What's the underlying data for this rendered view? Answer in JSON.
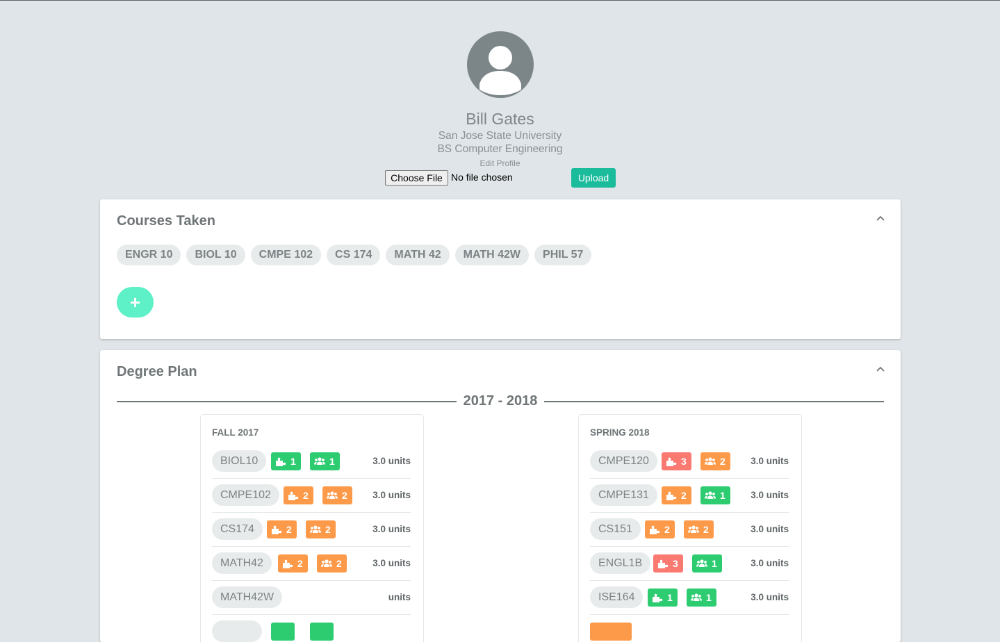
{
  "profile": {
    "name": "Bill Gates",
    "school": "San Jose State University",
    "degree": "BS Computer Engineering",
    "edit_link": "Edit Profile",
    "choose_file_label": "Choose File",
    "file_status": "No file chosen",
    "upload_label": "Upload"
  },
  "courses_taken": {
    "title": "Courses Taken",
    "courses": [
      "ENGR 10",
      "BIOL 10",
      "CMPE 102",
      "CS 174",
      "MATH 42",
      "MATH 42W",
      "PHIL 57"
    ],
    "add_label": "+"
  },
  "degree_plan": {
    "title": "Degree Plan",
    "year": "2017 - 2018",
    "terms": [
      {
        "title": "FALL 2017",
        "courses": [
          {
            "code": "BIOL10",
            "difficulty": "1",
            "difficulty_color": "green",
            "workload": "1",
            "workload_color": "green",
            "units": "3.0 units"
          },
          {
            "code": "CMPE102",
            "difficulty": "2",
            "difficulty_color": "orange",
            "workload": "2",
            "workload_color": "orange",
            "units": "3.0 units"
          },
          {
            "code": "CS174",
            "difficulty": "2",
            "difficulty_color": "orange",
            "workload": "2",
            "workload_color": "orange",
            "units": "3.0 units"
          },
          {
            "code": "MATH42",
            "difficulty": "2",
            "difficulty_color": "orange",
            "workload": "2",
            "workload_color": "orange",
            "units": "3.0 units"
          },
          {
            "code": "MATH42W",
            "units": "units"
          }
        ]
      },
      {
        "title": "SPRING 2018",
        "courses": [
          {
            "code": "CMPE120",
            "difficulty": "3",
            "difficulty_color": "red",
            "workload": "2",
            "workload_color": "orange",
            "units": "3.0 units"
          },
          {
            "code": "CMPE131",
            "difficulty": "2",
            "difficulty_color": "orange",
            "workload": "1",
            "workload_color": "green",
            "units": "3.0 units"
          },
          {
            "code": "CS151",
            "difficulty": "2",
            "difficulty_color": "orange",
            "workload": "2",
            "workload_color": "orange",
            "units": "3.0 units"
          },
          {
            "code": "ENGL1B",
            "difficulty": "3",
            "difficulty_color": "red",
            "workload": "1",
            "workload_color": "green",
            "units": "3.0 units"
          },
          {
            "code": "ISE164",
            "difficulty": "1",
            "difficulty_color": "green",
            "workload": "1",
            "workload_color": "green",
            "units": "3.0 units"
          }
        ]
      }
    ]
  },
  "icons": {
    "difficulty": "puzzle-icon",
    "workload": "users-icon",
    "collapse": "chevron-up-icon",
    "avatar": "user-avatar-icon"
  },
  "colors": {
    "background": "#dfe5e8",
    "accent": "#1abc9c",
    "add_button": "#5ef0c6",
    "green": "#2ecc71",
    "orange": "#fd9a4a",
    "red": "#fa7a72"
  }
}
